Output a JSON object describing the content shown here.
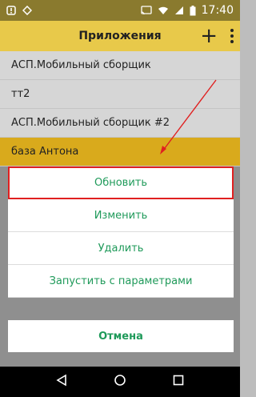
{
  "status_bar": {
    "time": "17:40",
    "icons": [
      "notification-icon",
      "diamond-icon",
      "cast-icon",
      "wifi-icon",
      "signal-icon",
      "battery-icon"
    ]
  },
  "app_bar": {
    "title": "Приложения",
    "add_icon": "plus-icon",
    "menu_icon": "more-vert-icon"
  },
  "list": {
    "items": [
      {
        "label": "АСП.Мобильный сборщик",
        "selected": false
      },
      {
        "label": "тт2",
        "selected": false
      },
      {
        "label": "АСП.Мобильный сборщик #2",
        "selected": false
      },
      {
        "label": "база Антона",
        "selected": true
      }
    ]
  },
  "action_sheet": {
    "buttons": [
      {
        "label": "Обновить",
        "highlighted": true
      },
      {
        "label": "Изменить"
      },
      {
        "label": "Удалить"
      },
      {
        "label": "Запустить с параметрами"
      }
    ],
    "cancel_label": "Отмена"
  },
  "nav_bar": {
    "icons": [
      "back-icon",
      "home-icon",
      "recents-icon"
    ]
  },
  "colors": {
    "accent_text": "#1f9a5a",
    "app_bar": "#e8c94a",
    "selected_item": "#d9aa1c",
    "highlight_border": "#e02020"
  }
}
